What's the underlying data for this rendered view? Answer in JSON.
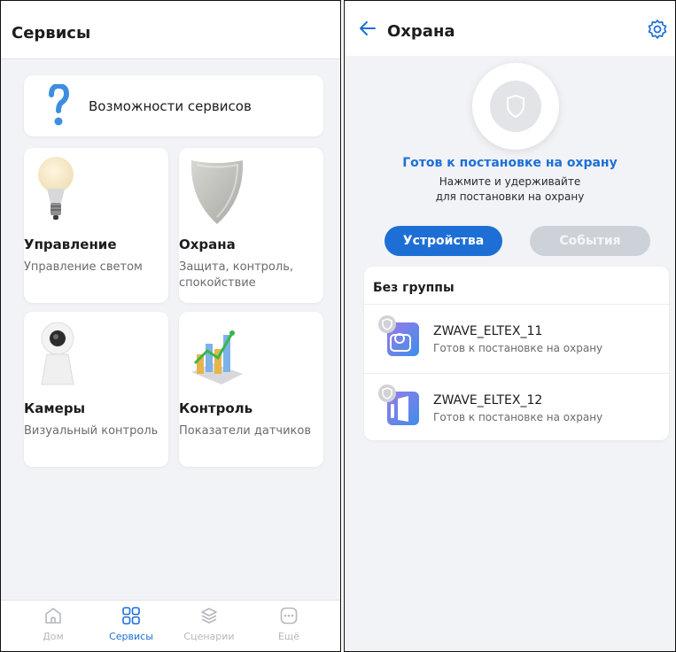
{
  "services_screen": {
    "title": "Сервисы",
    "capabilities_label": "Возможности сервисов",
    "services": [
      {
        "title": "Управление",
        "subtitle": "Управление светом",
        "icon": "light-bulb-icon"
      },
      {
        "title": "Охрана",
        "subtitle": "Защита, контроль, спокойствие",
        "icon": "shield-icon"
      },
      {
        "title": "Камеры",
        "subtitle": "Визуальный контроль",
        "icon": "camera-icon"
      },
      {
        "title": "Контроль",
        "subtitle": "Показатели датчиков",
        "icon": "chart-icon"
      }
    ],
    "tabs": [
      {
        "label": "Дом",
        "icon": "home-icon",
        "active": false
      },
      {
        "label": "Сервисы",
        "icon": "grid-icon",
        "active": true
      },
      {
        "label": "Сценарии",
        "icon": "layers-icon",
        "active": false
      },
      {
        "label": "Ещё",
        "icon": "more-icon",
        "active": false
      }
    ]
  },
  "security_screen": {
    "title": "Охрана",
    "status_main": "Готов к постановке на охрану",
    "status_hint_1": "Нажмите и удерживайте",
    "status_hint_2": "для постановки на охрану",
    "tab_devices": "Устройства",
    "tab_events": "События",
    "group_title": "Без группы",
    "devices": [
      {
        "name": "ZWAVE_ELTEX_11",
        "status": "Готов к постановке на охрану",
        "icon": "motion-sensor-icon"
      },
      {
        "name": "ZWAVE_ELTEX_12",
        "status": "Готов к постановке на охрану",
        "icon": "door-sensor-icon"
      }
    ]
  },
  "colors": {
    "accent": "#1d6fd6",
    "inactive": "#cdd2d9",
    "background": "#f2f3f6"
  }
}
